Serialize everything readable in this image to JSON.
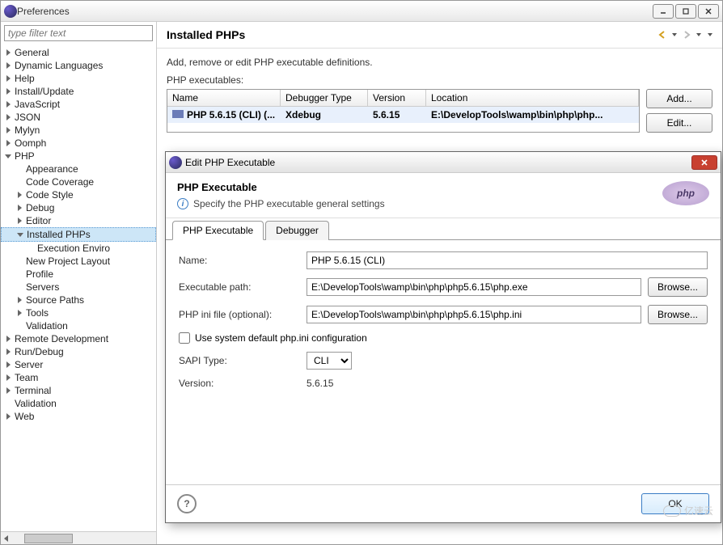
{
  "window": {
    "title": "Preferences",
    "filter_placeholder": "type filter text"
  },
  "tree": [
    {
      "label": "General",
      "indent": 0,
      "expand": "r"
    },
    {
      "label": "Dynamic Languages",
      "indent": 0,
      "expand": "r"
    },
    {
      "label": "Help",
      "indent": 0,
      "expand": "r"
    },
    {
      "label": "Install/Update",
      "indent": 0,
      "expand": "r"
    },
    {
      "label": "JavaScript",
      "indent": 0,
      "expand": "r"
    },
    {
      "label": "JSON",
      "indent": 0,
      "expand": "r"
    },
    {
      "label": "Mylyn",
      "indent": 0,
      "expand": "r"
    },
    {
      "label": "Oomph",
      "indent": 0,
      "expand": "r"
    },
    {
      "label": "PHP",
      "indent": 0,
      "expand": "d"
    },
    {
      "label": "Appearance",
      "indent": 1,
      "expand": ""
    },
    {
      "label": "Code Coverage",
      "indent": 1,
      "expand": ""
    },
    {
      "label": "Code Style",
      "indent": 1,
      "expand": "r"
    },
    {
      "label": "Debug",
      "indent": 1,
      "expand": "r"
    },
    {
      "label": "Editor",
      "indent": 1,
      "expand": "r"
    },
    {
      "label": "Installed PHPs",
      "indent": 1,
      "expand": "d",
      "selected": true
    },
    {
      "label": "Execution Enviro",
      "indent": 2,
      "expand": ""
    },
    {
      "label": "New Project Layout",
      "indent": 1,
      "expand": ""
    },
    {
      "label": "Profile",
      "indent": 1,
      "expand": ""
    },
    {
      "label": "Servers",
      "indent": 1,
      "expand": ""
    },
    {
      "label": "Source Paths",
      "indent": 1,
      "expand": "r"
    },
    {
      "label": "Tools",
      "indent": 1,
      "expand": "r"
    },
    {
      "label": "Validation",
      "indent": 1,
      "expand": ""
    },
    {
      "label": "Remote Development",
      "indent": 0,
      "expand": "r"
    },
    {
      "label": "Run/Debug",
      "indent": 0,
      "expand": "r"
    },
    {
      "label": "Server",
      "indent": 0,
      "expand": "r"
    },
    {
      "label": "Team",
      "indent": 0,
      "expand": "r"
    },
    {
      "label": "Terminal",
      "indent": 0,
      "expand": "r"
    },
    {
      "label": "Validation",
      "indent": 0,
      "expand": ""
    },
    {
      "label": "Web",
      "indent": 0,
      "expand": "r"
    }
  ],
  "content": {
    "heading": "Installed PHPs",
    "description": "Add, remove or edit PHP executable definitions.",
    "list_label": "PHP executables:",
    "columns": {
      "name": "Name",
      "debugger": "Debugger Type",
      "version": "Version",
      "location": "Location"
    },
    "row": {
      "name": "PHP 5.6.15 (CLI) (...",
      "debugger": "Xdebug",
      "version": "5.6.15",
      "location": "E:\\DevelopTools\\wamp\\bin\\php\\php..."
    },
    "buttons": {
      "add": "Add...",
      "edit": "Edit..."
    }
  },
  "dialog": {
    "title": "Edit PHP Executable",
    "header": "PHP Executable",
    "subtitle": "Specify the PHP executable general settings",
    "logo_text": "php",
    "tabs": {
      "exec": "PHP Executable",
      "debug": "Debugger"
    },
    "form": {
      "name_label": "Name:",
      "name_value": "PHP 5.6.15 (CLI)",
      "exec_label": "Executable path:",
      "exec_value": "E:\\DevelopTools\\wamp\\bin\\php\\php5.6.15\\php.exe",
      "ini_label": "PHP ini file (optional):",
      "ini_value": "E:\\DevelopTools\\wamp\\bin\\php\\php5.6.15\\php.ini",
      "checkbox_label": "Use system default php.ini configuration",
      "sapi_label": "SAPI Type:",
      "sapi_value": "CLI",
      "version_label": "Version:",
      "version_value": "5.6.15",
      "browse": "Browse..."
    },
    "footer": {
      "ok": "OK",
      "help": "?"
    }
  },
  "watermark": "亿速云"
}
